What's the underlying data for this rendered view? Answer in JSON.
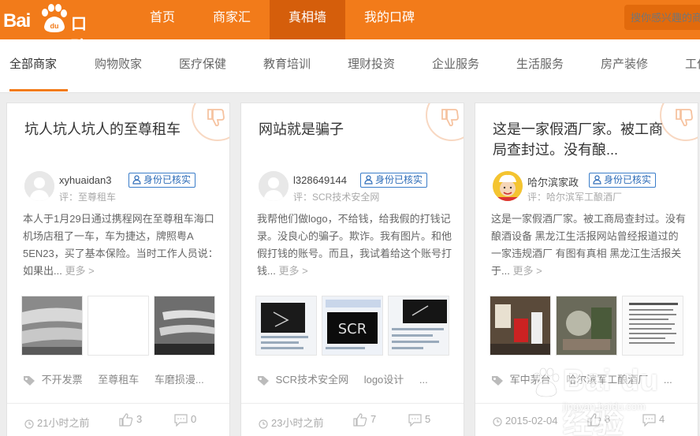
{
  "header": {
    "logo_text": "Bai",
    "logo_paw_text": "du",
    "logo_suffix": "口碑",
    "nav": [
      "首页",
      "商家汇",
      "真相墙",
      "我的口碑"
    ],
    "active_nav": 2,
    "search_placeholder": "搜你感兴趣的商"
  },
  "categories": [
    "全部商家",
    "购物败家",
    "医疗保健",
    "教育培训",
    "理财投资",
    "企业服务",
    "生活服务",
    "房产装修",
    "工作"
  ],
  "active_category": 0,
  "badge_label": "身份已核实",
  "more_label": "更多 >",
  "cards": [
    {
      "title": "坑人坑人坑人的至尊租车",
      "author": "xyhuaidan3",
      "review_of": "评：至尊租车",
      "excerpt": "本人于1月29日通过携程网在至尊租车海口机场店租了一车，车为捷达，牌照粤A 5EN23，买了基本保险。当时工作人员说：如果出...",
      "tags": [
        "不开发票",
        "至尊租车",
        "车磨损漫..."
      ],
      "time": "21小时之前",
      "likes": "3",
      "comments": "0"
    },
    {
      "title": "网站就是骗子",
      "author": "l328649144",
      "review_of": "评：SCR技术安全网",
      "excerpt": "我帮他们做logo，不给钱，给我假的打钱记录。没良心的骗子。欺诈。我有图片。和他假打钱的账号。而且，我试着给这个账号打钱...",
      "tags": [
        "SCR技术安全网",
        "logo设计",
        "..."
      ],
      "time": "23小时之前",
      "likes": "7",
      "comments": "5"
    },
    {
      "title": "这是一家假酒厂家。被工商局查封过。没有酿...",
      "author": "哈尔滨家政",
      "review_of": "评：哈尔滨军工酿酒厂",
      "excerpt": "这是一家假酒厂家。被工商局查封过。没有酿酒设备 黑龙江生活报网站曾经报道过的一家违规酒厂 有图有真相 黑龙江生活报关于...",
      "tags": [
        "军中茅台",
        "哈尔滨军工酿酒厂",
        "..."
      ],
      "time": "2015-02-04",
      "likes": "8",
      "comments": "4"
    }
  ],
  "watermark": {
    "text": "Bai du 经验",
    "url": "jingyan.baidu.com"
  },
  "colors": {
    "brand": "#f27b1a",
    "nav_active": "#d55e0b",
    "badge_blue": "#2d6cb8"
  }
}
